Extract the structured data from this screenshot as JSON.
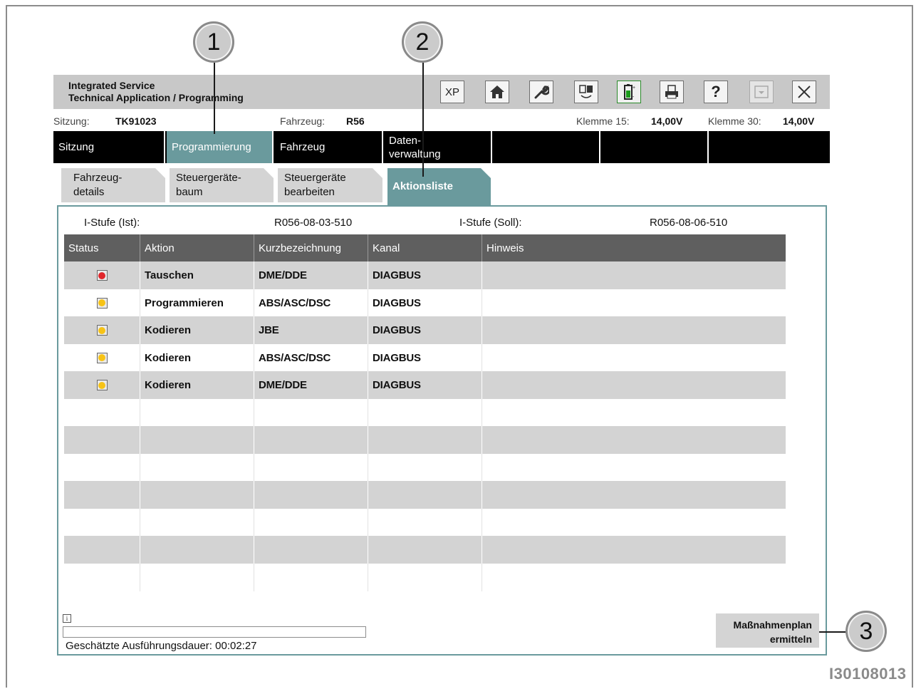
{
  "app": {
    "title_line1": "Integrated Service",
    "title_line2": "Technical Application / Programming"
  },
  "toolbar": [
    {
      "icon": "xp-icon",
      "label": "XP"
    },
    {
      "icon": "home-icon"
    },
    {
      "icon": "wrench-icon"
    },
    {
      "icon": "measure-icon"
    },
    {
      "icon": "battery-icon"
    },
    {
      "icon": "print-icon"
    },
    {
      "icon": "help-icon",
      "label": "?"
    },
    {
      "icon": "minimize-icon",
      "disabled": true
    },
    {
      "icon": "close-icon",
      "label": "×"
    }
  ],
  "info": {
    "sitzung_label": "Sitzung:",
    "sitzung_value": "TK91023",
    "fahrzeug_label": "Fahrzeug:",
    "fahrzeug_value": "R56",
    "klemme15_label": "Klemme 15:",
    "klemme15_value": "14,00V",
    "klemme30_label": "Klemme 30:",
    "klemme30_value": "14,00V"
  },
  "main_nav": [
    {
      "line1": "Sitzung",
      "line2": ""
    },
    {
      "line1": "Programmierung",
      "line2": "",
      "active": true
    },
    {
      "line1": "Fahrzeug",
      "line2": ""
    },
    {
      "line1": "Daten-",
      "line2": "verwaltung"
    },
    {
      "line1": "",
      "line2": ""
    },
    {
      "line1": "",
      "line2": ""
    },
    {
      "line1": "",
      "line2": ""
    }
  ],
  "sub_tabs": [
    {
      "line1": "Fahrzeug-",
      "line2": "details"
    },
    {
      "line1": "Steuergeräte-",
      "line2": "baum"
    },
    {
      "line1": "Steuergeräte",
      "line2": "bearbeiten"
    },
    {
      "line1": "Aktionsliste",
      "line2": "",
      "active": true
    }
  ],
  "istufe": {
    "ist_label": "I-Stufe (Ist):",
    "ist_value": "R056-08-03-510",
    "soll_label": "I-Stufe (Soll):",
    "soll_value": "R056-08-06-510"
  },
  "table": {
    "headers": [
      "Status",
      "Aktion",
      "Kurzbezeichnung",
      "Kanal",
      "Hinweis"
    ],
    "rows": [
      {
        "status": "red",
        "aktion": "Tauschen",
        "kurz": "DME/DDE",
        "kanal": "DIAGBUS",
        "hinweis": ""
      },
      {
        "status": "yellow",
        "aktion": "Programmieren",
        "kurz": "ABS/ASC/DSC",
        "kanal": "DIAGBUS",
        "hinweis": ""
      },
      {
        "status": "yellow",
        "aktion": "Kodieren",
        "kurz": "JBE",
        "kanal": "DIAGBUS",
        "hinweis": ""
      },
      {
        "status": "yellow",
        "aktion": "Kodieren",
        "kurz": "ABS/ASC/DSC",
        "kanal": "DIAGBUS",
        "hinweis": ""
      },
      {
        "status": "yellow",
        "aktion": "Kodieren",
        "kurz": "DME/DDE",
        "kanal": "DIAGBUS",
        "hinweis": ""
      },
      {
        "status": "",
        "aktion": "",
        "kurz": "",
        "kanal": "",
        "hinweis": ""
      },
      {
        "status": "",
        "aktion": "",
        "kurz": "",
        "kanal": "",
        "hinweis": ""
      },
      {
        "status": "",
        "aktion": "",
        "kurz": "",
        "kanal": "",
        "hinweis": ""
      },
      {
        "status": "",
        "aktion": "",
        "kurz": "",
        "kanal": "",
        "hinweis": ""
      },
      {
        "status": "",
        "aktion": "",
        "kurz": "",
        "kanal": "",
        "hinweis": ""
      },
      {
        "status": "",
        "aktion": "",
        "kurz": "",
        "kanal": "",
        "hinweis": ""
      },
      {
        "status": "",
        "aktion": "",
        "kurz": "",
        "kanal": "",
        "hinweis": ""
      }
    ]
  },
  "status_colors": {
    "red": "#e0262b",
    "yellow": "#f7c316",
    "teal": "#6a9a9d"
  },
  "footer": {
    "info_icon": "i",
    "progress": 0,
    "duration_label": "Geschätzte Ausführungsdauer:",
    "duration_value": "00:02:27",
    "plan_button_line1": "Maßnahmenplan",
    "plan_button_line2": "ermitteln"
  },
  "callouts": [
    "1",
    "2",
    "3"
  ],
  "figure_id": "I30108013"
}
